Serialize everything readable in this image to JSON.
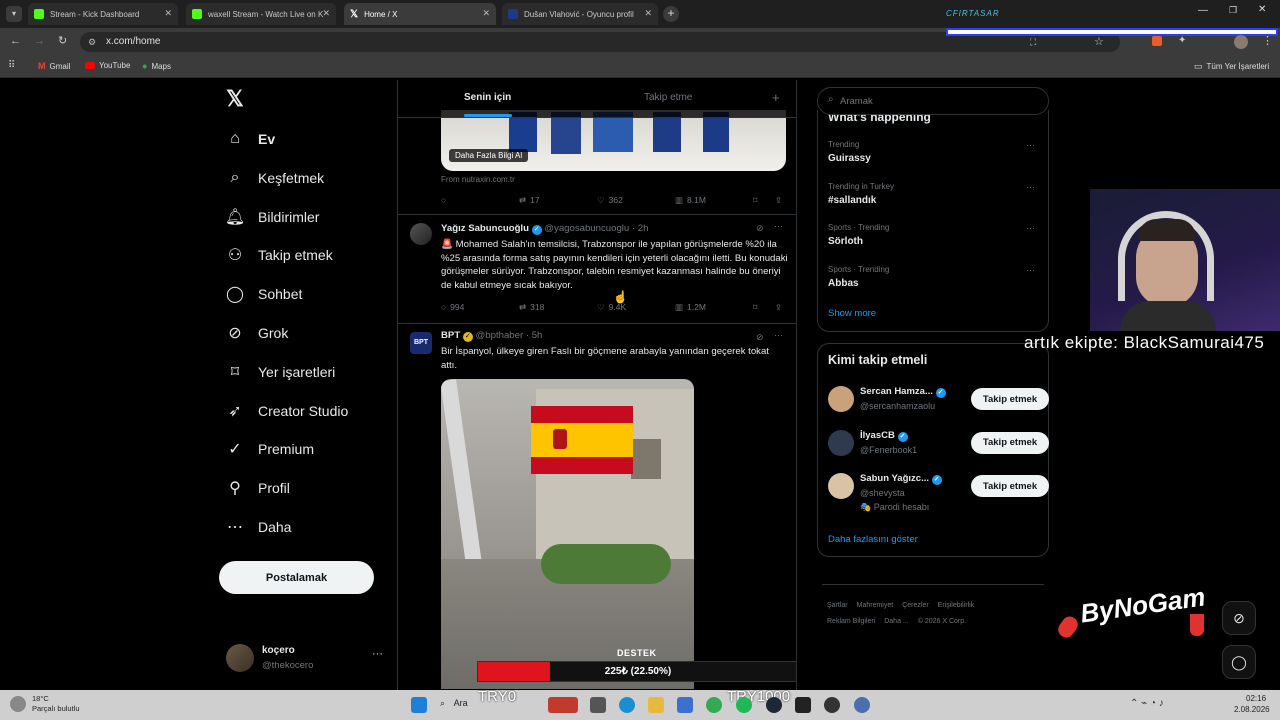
{
  "browser": {
    "tabs": [
      {
        "title": "Stream - Kick Dashboard",
        "color": "#53fc18"
      },
      {
        "title": "waxell Stream - Watch Live on K",
        "color": "#53fc18"
      },
      {
        "title": "Home / X",
        "color": "#ffffff"
      },
      {
        "title": "Dušan Vlahović - Oyuncu profil",
        "color": "#1d3a8a"
      }
    ],
    "url": "x.com/home",
    "bookmarks": [
      "Gmail",
      "YouTube",
      "Maps"
    ],
    "all_bookmarks": "Tüm Yer İşaretleri",
    "overlay_text": "CFIRTASAR"
  },
  "nav": {
    "items": [
      {
        "label": "Ev",
        "icon": "home-icon"
      },
      {
        "label": "Keşfetmek",
        "icon": "search-icon"
      },
      {
        "label": "Bildirimler",
        "icon": "bell-icon"
      },
      {
        "label": "Takip etmek",
        "icon": "add-person-icon"
      },
      {
        "label": "Sohbet",
        "icon": "chat-icon"
      },
      {
        "label": "Grok",
        "icon": "grok-icon"
      },
      {
        "label": "Yer işaretleri",
        "icon": "bookmark-icon"
      },
      {
        "label": "Creator Studio",
        "icon": "rocket-icon"
      },
      {
        "label": "Premium",
        "icon": "verified-icon"
      },
      {
        "label": "Profil",
        "icon": "person-icon"
      },
      {
        "label": "Daha",
        "icon": "more-circle-icon"
      }
    ],
    "post_button": "Postalamak",
    "account": {
      "name": "koçero",
      "handle": "@thekocero"
    }
  },
  "feed": {
    "tabs": [
      "Senin için",
      "Takip etme"
    ],
    "ad": {
      "cta": "Daha Fazla Bilgi Al",
      "source": "From nutraxin.com.tr",
      "replies": "",
      "reposts": "17",
      "likes": "362",
      "views": "8.1M"
    },
    "tweets": [
      {
        "name": "Yağız Sabuncuoğlu",
        "handle": "@yagosabuncuoglu",
        "time": "· 2h",
        "text": "🚨 Mohamed Salah'ın temsilcisi, Trabzonspor ile yapılan görüşmelerde %20 ila %25 arasında forma satış payının kendileri için yeterli olacağını iletti. Bu konudaki görüşmeler sürüyor. Trabzonspor, talebin resmiyet kazanması halinde bu öneriyi de kabul etmeye sıcak bakıyor.",
        "replies": "994",
        "reposts": "318",
        "likes": "9.4K",
        "views": "1.2M"
      },
      {
        "name": "BPT",
        "handle": "@bpthaber",
        "time": "· 5h",
        "text": "Bir İspanyol, ülkeye giren Faslı bir göçmene arabayla yanından geçerek tokat attı."
      }
    ]
  },
  "right": {
    "search_placeholder": "Aramak",
    "happening_title": "What's happening",
    "trends": [
      {
        "meta": "Trending",
        "name": "Guirassy"
      },
      {
        "meta": "Trending in Turkey",
        "name": "#sallandık"
      },
      {
        "meta": "Sports · Trending",
        "name": "Sörloth"
      },
      {
        "meta": "Sports · Trending",
        "name": "Abbas"
      }
    ],
    "show_more": "Show more",
    "who_to_follow_title": "Kimi takip etmeli",
    "follow": [
      {
        "name": "Sercan Hamza...",
        "handle": "@sercanhamzaolu",
        "button": "Takip etmek",
        "note": ""
      },
      {
        "name": "İlyasCB",
        "handle": "@Fenerbook1",
        "button": "Takip etmek",
        "note": ""
      },
      {
        "name": "Sabun Yağızc...",
        "handle": "@shevysta",
        "button": "Takip etmek",
        "note": "🎭 Parodi hesabı"
      }
    ],
    "show_more_follow": "Daha fazlasını göster",
    "footer": [
      "Şartlar",
      "Mahremiyet",
      "Çerezler",
      "Erişilebilirlik",
      "Reklam Bilgileri",
      "Daha ...",
      "© 2026 X Corp."
    ]
  },
  "stream_overlay": {
    "team_text": "artık ekipte: BlackSamurai475",
    "logo": "ByNoGam",
    "donation_label": "DESTEK",
    "donation_progress": "225₺ (22.50%)",
    "donation_fraction": 0.225,
    "goal_left": "TRY0",
    "goal_right": "TRY1000"
  },
  "taskbar": {
    "temp": "18°C",
    "weather": "Parçalı bulutlu",
    "search": "Ara",
    "time": "02:16",
    "date": "2.08.2026"
  }
}
